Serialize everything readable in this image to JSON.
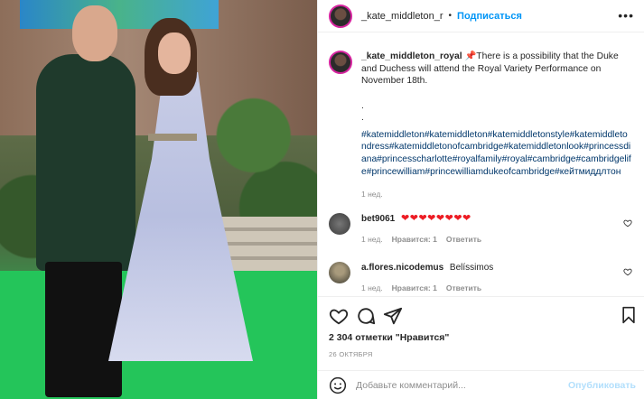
{
  "header": {
    "username": "_kate_middleton_r",
    "separator": "•",
    "follow": "Подписаться",
    "more": "•••"
  },
  "caption": {
    "username": "_kate_middleton_royal",
    "pin": "📌",
    "text": "There is a possibility that the Duke and Duchess will attend the Royal Variety Performance on November 18th.",
    "dot1": ".",
    "dot2": ".",
    "hashtags": "#katemiddleton#katemiddleton#katemiddletonstyle#katemiddletondress#katemiddletonofcambridge#katemiddletonlook#princessdiana#princesscharlotte#royalfamily#royal#cambridge#cambridgelife#princewilliam#princewilliamdukeofcambridge#кейтмиддлтон",
    "time": "1 нед."
  },
  "comments": [
    {
      "username": "bet9061",
      "text": "❤❤❤❤❤❤❤❤",
      "time": "1 нед.",
      "likes": "Нравится: 1",
      "reply": "Ответить"
    },
    {
      "username": "a.flores.nicodemus",
      "text": "Belíssimos",
      "time": "1 нед.",
      "likes": "Нравится: 1",
      "reply": "Ответить"
    }
  ],
  "likes": "2 304 отметки \"Нравится\"",
  "date": "26 ОКТЯБРЯ",
  "add_comment": {
    "placeholder": "Добавьте комментарий...",
    "publish": "Опубликовать"
  },
  "icons": {
    "like": "heart-outline-icon",
    "comment": "comment-bubble-icon",
    "share": "paper-plane-icon",
    "save": "bookmark-icon",
    "emoji": "smiley-icon",
    "comment_like": "small-heart-icon"
  },
  "colors": {
    "accent": "#0095f6",
    "hashtag": "#00376b",
    "muted": "#8e8e8e",
    "heart": "#ed1c24"
  }
}
